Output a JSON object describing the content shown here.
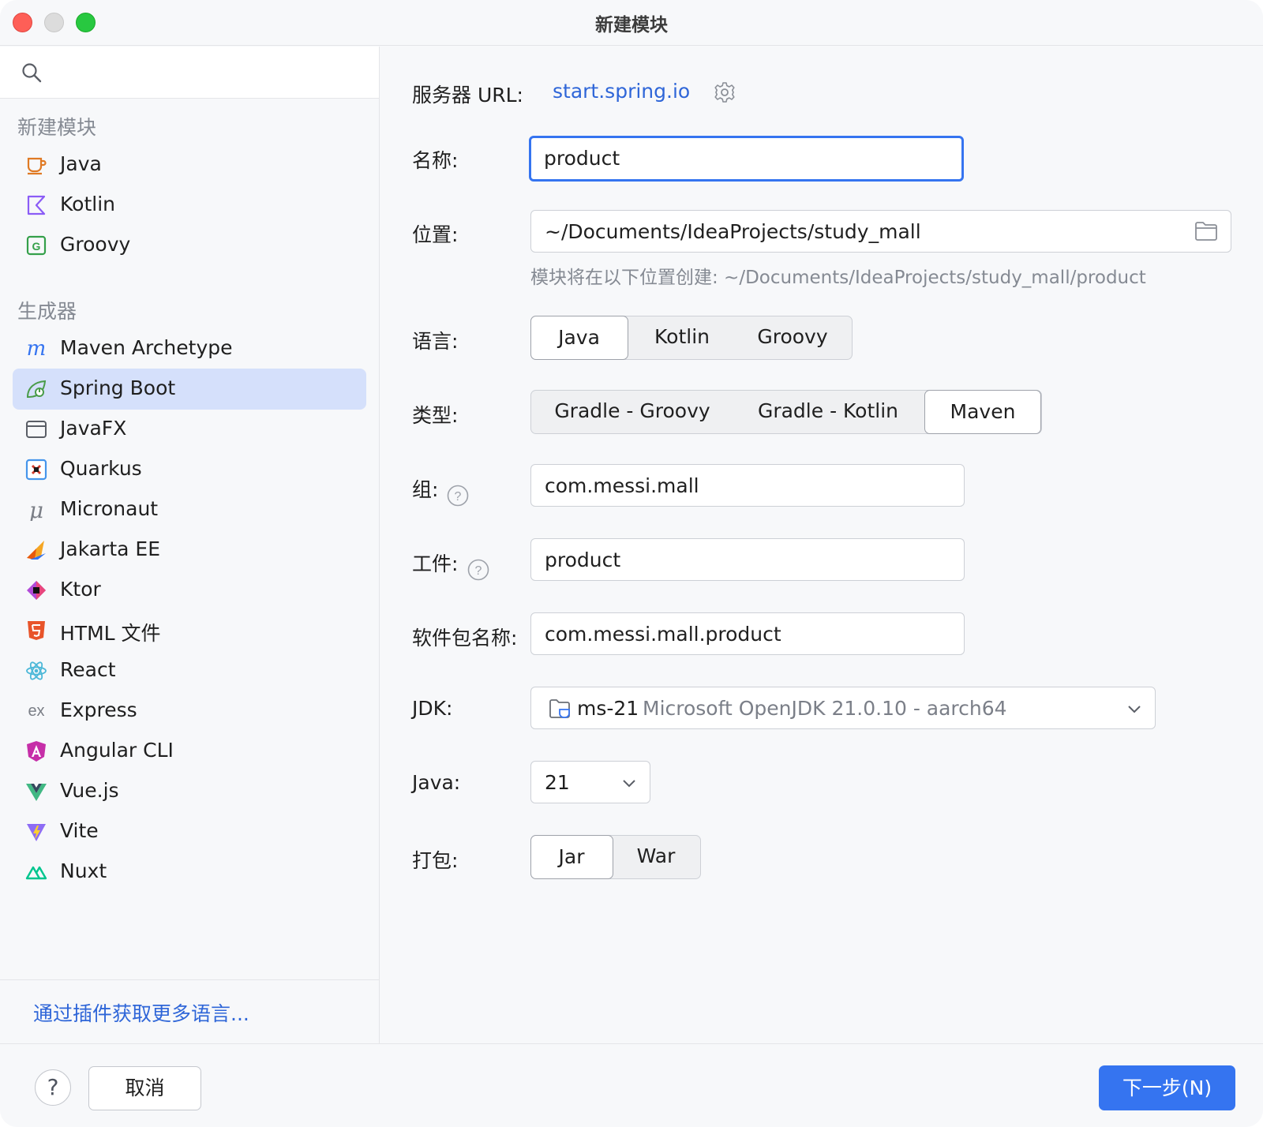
{
  "window": {
    "title": "新建模块"
  },
  "sidebar": {
    "search": {
      "placeholder": ""
    },
    "sections": [
      {
        "label": "新建模块"
      },
      {
        "label": "生成器"
      }
    ],
    "new_module_items": [
      {
        "label": "Java",
        "icon": "java-icon"
      },
      {
        "label": "Kotlin",
        "icon": "kotlin-icon"
      },
      {
        "label": "Groovy",
        "icon": "groovy-icon"
      }
    ],
    "generator_items": [
      {
        "label": "Maven Archetype",
        "icon": "maven-icon"
      },
      {
        "label": "Spring Boot",
        "icon": "spring-boot-icon",
        "selected": true
      },
      {
        "label": "JavaFX",
        "icon": "javafx-icon"
      },
      {
        "label": "Quarkus",
        "icon": "quarkus-icon"
      },
      {
        "label": "Micronaut",
        "icon": "micronaut-icon"
      },
      {
        "label": "Jakarta EE",
        "icon": "jakarta-ee-icon"
      },
      {
        "label": "Ktor",
        "icon": "ktor-icon"
      },
      {
        "label": "HTML 文件",
        "icon": "html5-icon"
      },
      {
        "label": "React",
        "icon": "react-icon"
      },
      {
        "label": "Express",
        "icon": "express-icon"
      },
      {
        "label": "Angular CLI",
        "icon": "angular-icon"
      },
      {
        "label": "Vue.js",
        "icon": "vue-icon"
      },
      {
        "label": "Vite",
        "icon": "vite-icon"
      },
      {
        "label": "Nuxt",
        "icon": "nuxt-icon"
      }
    ],
    "plugin_link": "通过插件获取更多语言..."
  },
  "form": {
    "server_url": {
      "label": "服务器 URL:",
      "value": "start.spring.io"
    },
    "name": {
      "label": "名称:",
      "value": "product"
    },
    "location": {
      "label": "位置:",
      "value": "~/Documents/IdeaProjects/study_mall",
      "hint": "模块将在以下位置创建: ~/Documents/IdeaProjects/study_mall/product"
    },
    "language": {
      "label": "语言:",
      "options": [
        "Java",
        "Kotlin",
        "Groovy"
      ],
      "selected": "Java"
    },
    "type": {
      "label": "类型:",
      "options": [
        "Gradle - Groovy",
        "Gradle - Kotlin",
        "Maven"
      ],
      "selected": "Maven"
    },
    "group": {
      "label": "组:",
      "value": "com.messi.mall"
    },
    "artifact": {
      "label": "工件:",
      "value": "product"
    },
    "package": {
      "label": "软件包名称:",
      "value": "com.messi.mall.product"
    },
    "jdk": {
      "label": "JDK:",
      "name": "ms-21",
      "detail": "Microsoft OpenJDK 21.0.10 - aarch64"
    },
    "java": {
      "label": "Java:",
      "value": "21"
    },
    "packaging": {
      "label": "打包:",
      "options": [
        "Jar",
        "War"
      ],
      "selected": "Jar"
    }
  },
  "footer": {
    "help_label": "?",
    "cancel_label": "取消",
    "next_label": "下一步(N)"
  },
  "colors": {
    "accent": "#3574f0",
    "link": "#2f66d8",
    "selection": "#d5e0fb",
    "background": "#f7f8fa"
  }
}
